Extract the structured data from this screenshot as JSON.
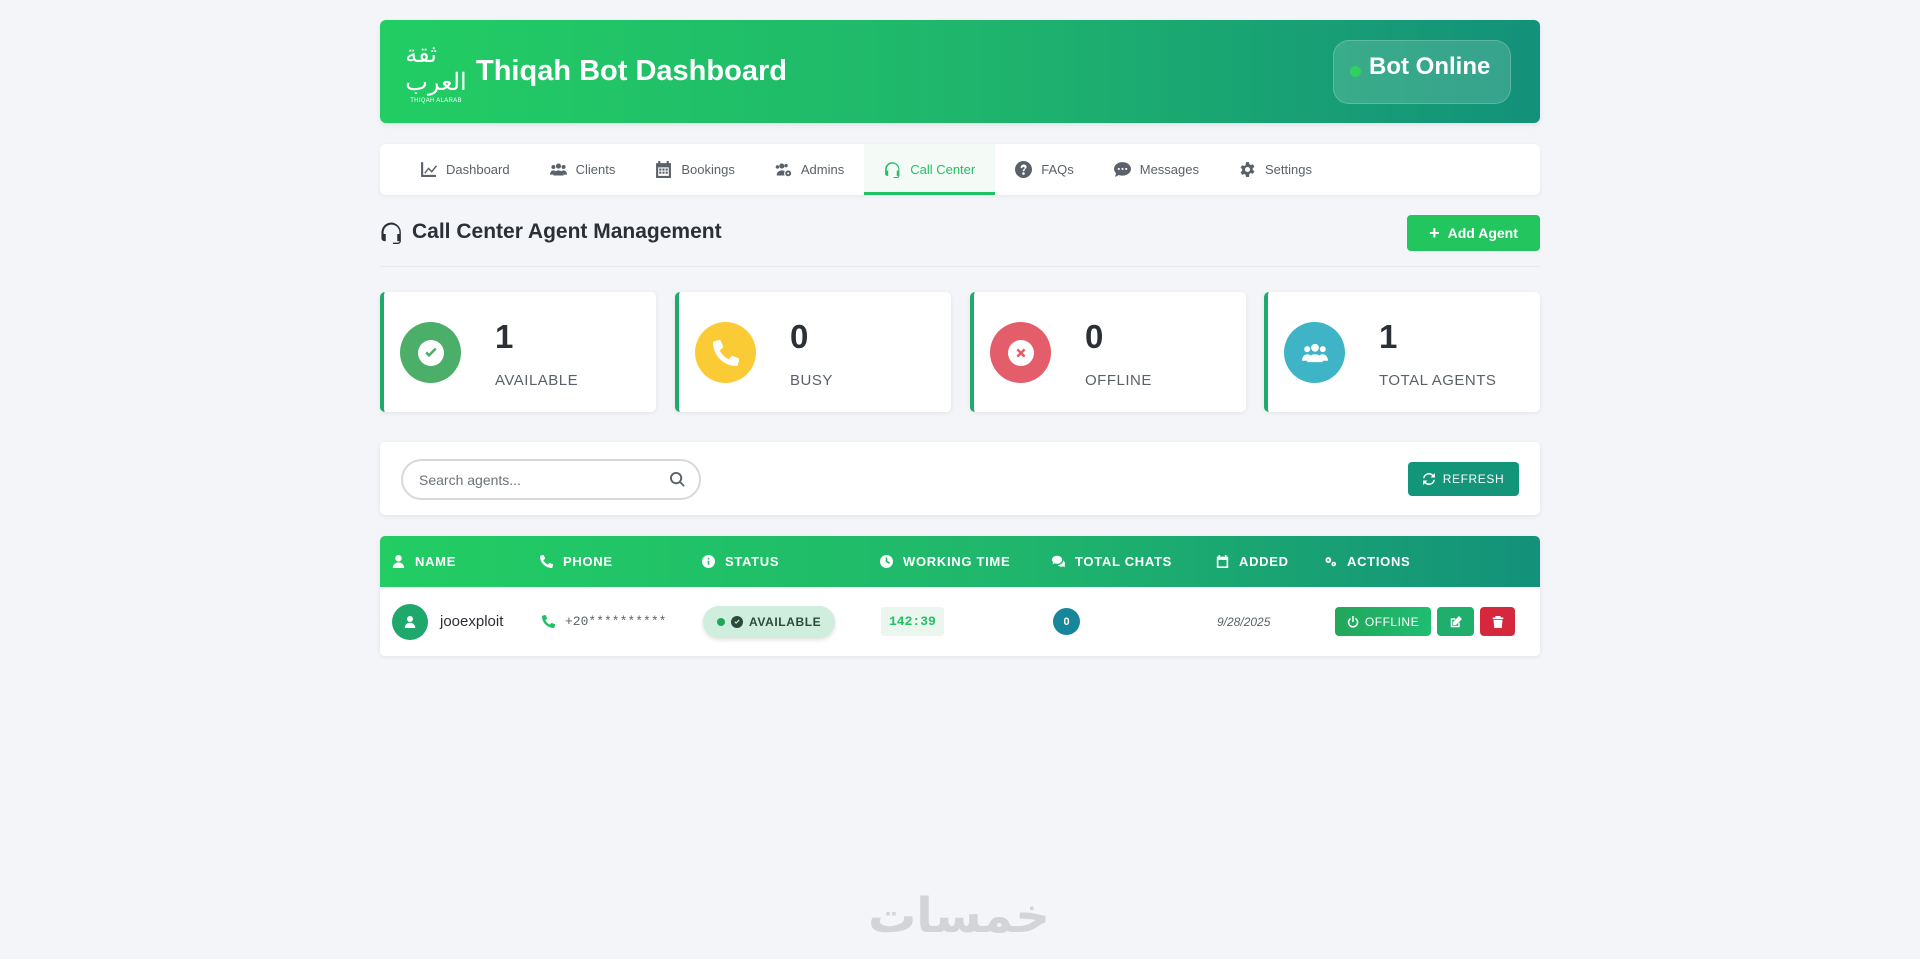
{
  "header": {
    "logo_ar": "ثقة العرب",
    "logo_en": "THIQAH ALARAB",
    "title": "Thiqah Bot Dashboard",
    "bot_status": "Bot Online",
    "bot_status_color": "#2fd160"
  },
  "nav": {
    "items": [
      {
        "label": "Dashboard",
        "icon": "chart-line-icon"
      },
      {
        "label": "Clients",
        "icon": "users-icon"
      },
      {
        "label": "Bookings",
        "icon": "calendar-icon"
      },
      {
        "label": "Admins",
        "icon": "users-cog-icon"
      },
      {
        "label": "Call Center",
        "icon": "headset-icon",
        "active": true
      },
      {
        "label": "FAQs",
        "icon": "question-circle-icon"
      },
      {
        "label": "Messages",
        "icon": "comment-dots-icon"
      },
      {
        "label": "Settings",
        "icon": "gear-icon"
      }
    ]
  },
  "section": {
    "title": "Call Center Agent Management",
    "add_button": "Add Agent"
  },
  "stats": [
    {
      "value": "1",
      "label": "AVAILABLE",
      "color": "#4caf69",
      "icon": "check-circle-icon"
    },
    {
      "value": "0",
      "label": "BUSY",
      "color": "#fbcb35",
      "icon": "phone-icon"
    },
    {
      "value": "0",
      "label": "OFFLINE",
      "color": "#e35d6a",
      "icon": "times-circle-icon"
    },
    {
      "value": "1",
      "label": "TOTAL AGENTS",
      "color": "#3fb4c7",
      "icon": "users-icon"
    }
  ],
  "search": {
    "placeholder": "Search agents...",
    "value": "",
    "refresh_button": "REFRESH"
  },
  "table": {
    "headers": [
      "NAME",
      "PHONE",
      "STATUS",
      "WORKING TIME",
      "TOTAL CHATS",
      "ADDED",
      "ACTIONS"
    ],
    "rows": [
      {
        "name": "jooexploit",
        "phone": "+20**********",
        "status": "AVAILABLE",
        "working_time": "142:39",
        "total_chats": "0",
        "added": "9/28/2025",
        "action_toggle": "OFFLINE"
      }
    ]
  },
  "watermark": "خمسات",
  "colors": {
    "accent": "#22c064",
    "header_start": "#22cd63",
    "header_end": "#13917a",
    "delete": "#d6283c"
  }
}
